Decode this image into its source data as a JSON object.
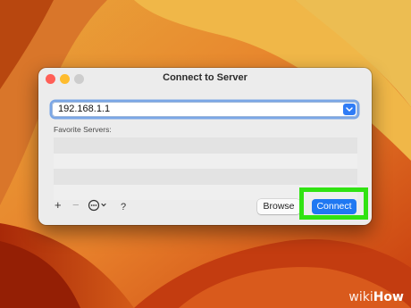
{
  "dialog": {
    "title": "Connect to Server",
    "address_value": "192.168.1.1",
    "favorites_label": "Favorite Servers:",
    "favorites_rows": [
      "",
      "",
      "",
      "",
      ""
    ],
    "add_label": "+",
    "remove_label": "−",
    "help_label": "?",
    "browse_label": "Browse",
    "connect_label": "Connect"
  },
  "icons": [
    "chevron-down-icon",
    "ellipsis-circle-icon",
    "chevron-down-small-icon"
  ],
  "colors": {
    "accent_blue": "#1f78f2",
    "highlight_green": "#31e312",
    "close_red": "#ff5f57",
    "minimize_yellow": "#febc2e"
  },
  "watermark": {
    "wiki": "wiki",
    "how": "How"
  }
}
